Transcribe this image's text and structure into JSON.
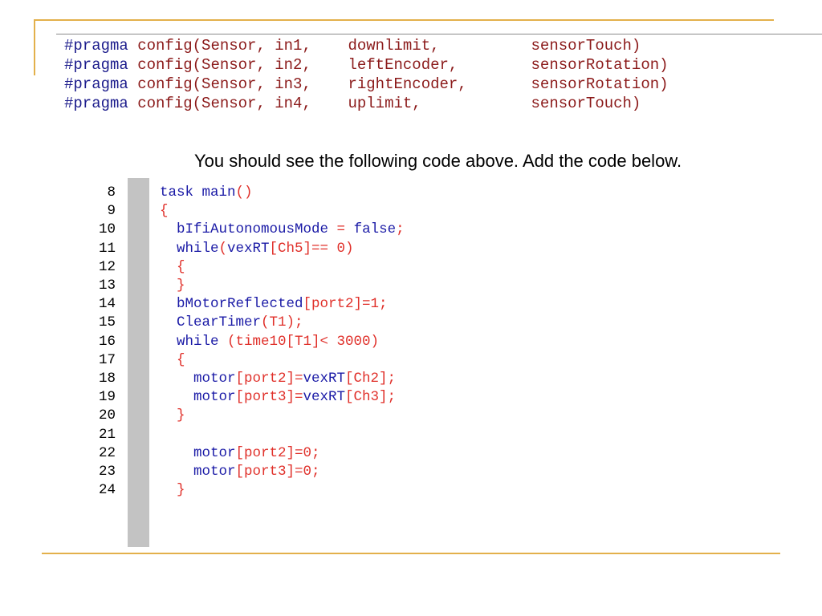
{
  "pragma_lines": [
    {
      "keyword": "#pragma",
      "text": " config(Sensor, in1,    downlimit,          sensorTouch)"
    },
    {
      "keyword": "#pragma",
      "text": " config(Sensor, in2,    leftEncoder,        sensorRotation)"
    },
    {
      "keyword": "#pragma",
      "text": " config(Sensor, in3,    rightEncoder,       sensorRotation)"
    },
    {
      "keyword": "#pragma",
      "text": " config(Sensor, in4,    uplimit,            sensorTouch)"
    }
  ],
  "instruction": "You should see the following code above. Add the code below.",
  "code_lines": [
    {
      "num": "8",
      "segments": [
        {
          "c": "kw",
          "t": "task main"
        },
        {
          "c": "tx",
          "t": "()"
        }
      ]
    },
    {
      "num": "9",
      "segments": [
        {
          "c": "tx",
          "t": "{"
        }
      ]
    },
    {
      "num": "10",
      "segments": [
        {
          "c": "kw",
          "t": "  bIfiAutonomousMode "
        },
        {
          "c": "tx",
          "t": "= "
        },
        {
          "c": "kw",
          "t": "false"
        },
        {
          "c": "tx",
          "t": ";"
        }
      ]
    },
    {
      "num": "11",
      "segments": [
        {
          "c": "kw",
          "t": "  while"
        },
        {
          "c": "tx",
          "t": "("
        },
        {
          "c": "kw",
          "t": "vexRT"
        },
        {
          "c": "tx",
          "t": "[Ch5]== 0)"
        }
      ]
    },
    {
      "num": "12",
      "segments": [
        {
          "c": "tx",
          "t": "  {"
        }
      ]
    },
    {
      "num": "13",
      "segments": [
        {
          "c": "tx",
          "t": "  }"
        }
      ]
    },
    {
      "num": "14",
      "segments": [
        {
          "c": "kw",
          "t": "  bMotorReflected"
        },
        {
          "c": "tx",
          "t": "[port2]=1;"
        }
      ]
    },
    {
      "num": "15",
      "segments": [
        {
          "c": "kw",
          "t": "  ClearTimer"
        },
        {
          "c": "tx",
          "t": "(T1);"
        }
      ]
    },
    {
      "num": "16",
      "segments": [
        {
          "c": "kw",
          "t": "  while "
        },
        {
          "c": "tx",
          "t": "(time10[T1]< 3000)"
        }
      ]
    },
    {
      "num": "17",
      "segments": [
        {
          "c": "tx",
          "t": "  {"
        }
      ]
    },
    {
      "num": "18",
      "segments": [
        {
          "c": "kw",
          "t": "    motor"
        },
        {
          "c": "tx",
          "t": "[port2]="
        },
        {
          "c": "kw",
          "t": "vexRT"
        },
        {
          "c": "tx",
          "t": "[Ch2];"
        }
      ]
    },
    {
      "num": "19",
      "segments": [
        {
          "c": "kw",
          "t": "    motor"
        },
        {
          "c": "tx",
          "t": "[port3]="
        },
        {
          "c": "kw",
          "t": "vexRT"
        },
        {
          "c": "tx",
          "t": "[Ch3];"
        }
      ]
    },
    {
      "num": "20",
      "segments": [
        {
          "c": "tx",
          "t": "  }"
        }
      ]
    },
    {
      "num": "21",
      "segments": []
    },
    {
      "num": "22",
      "segments": [
        {
          "c": "kw",
          "t": "    motor"
        },
        {
          "c": "tx",
          "t": "[port2]=0;"
        }
      ]
    },
    {
      "num": "23",
      "segments": [
        {
          "c": "kw",
          "t": "    motor"
        },
        {
          "c": "tx",
          "t": "[port3]=0;"
        }
      ]
    },
    {
      "num": "24",
      "segments": [
        {
          "c": "tx",
          "t": "  }"
        }
      ]
    }
  ]
}
